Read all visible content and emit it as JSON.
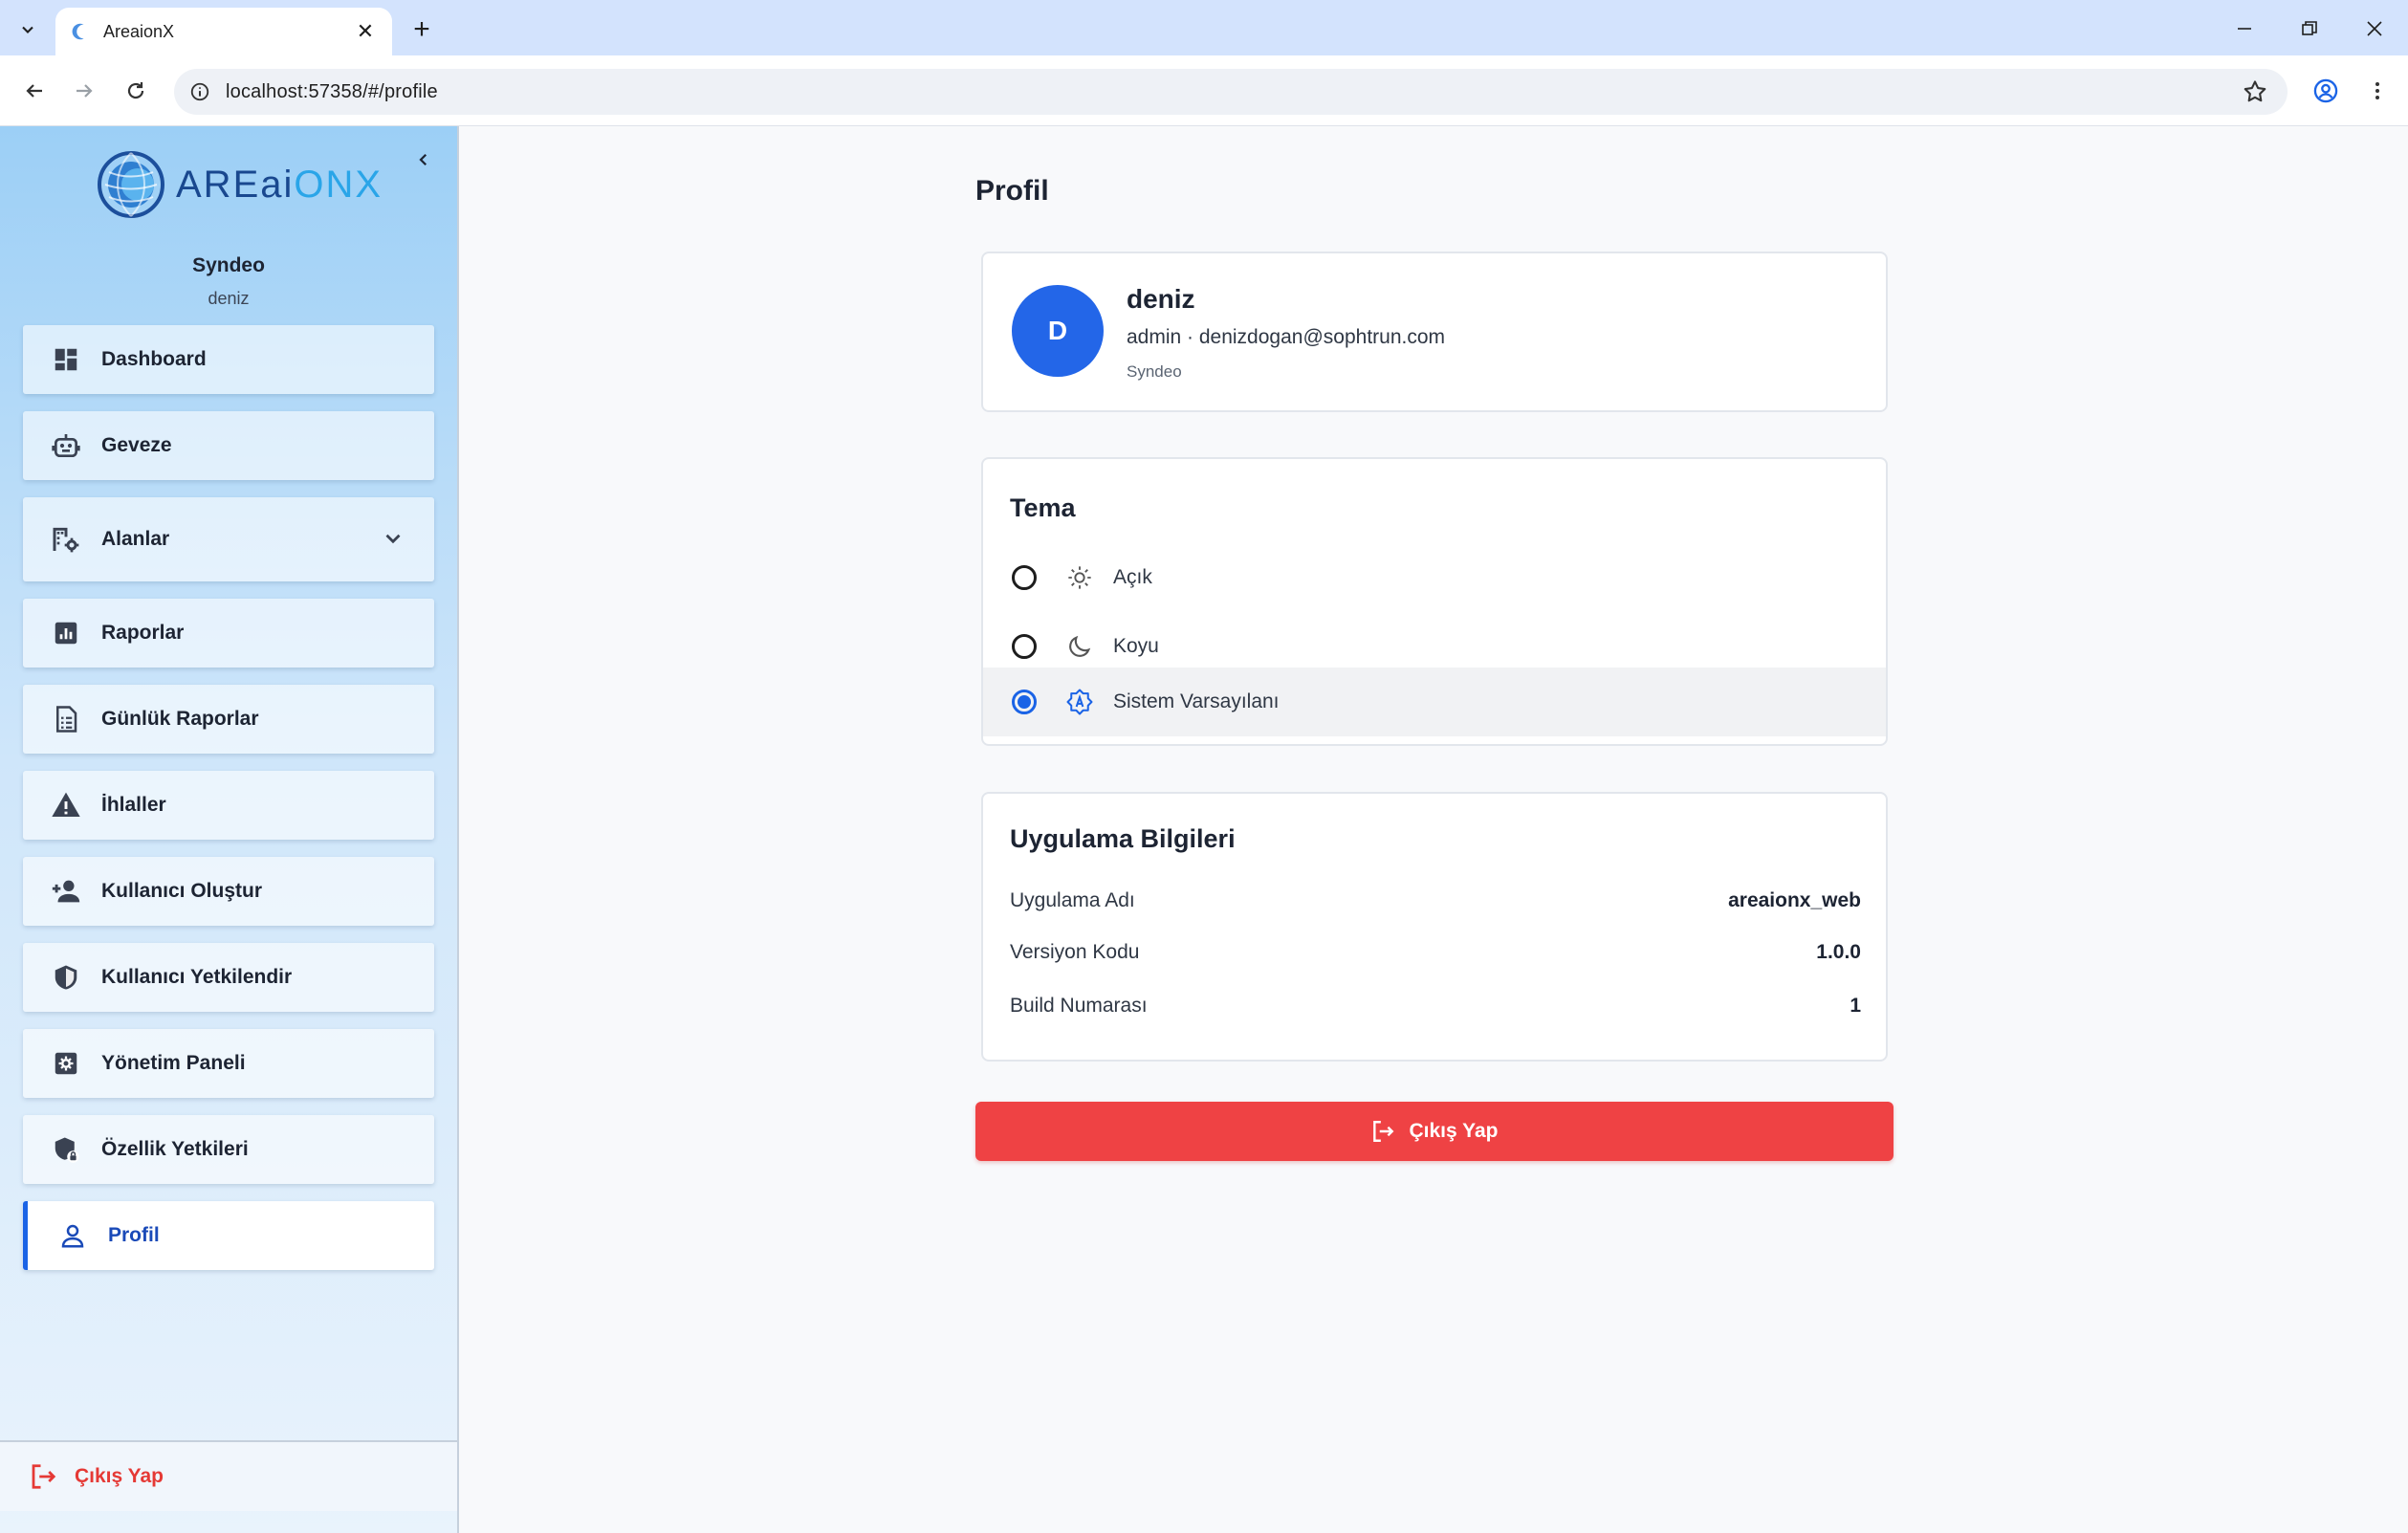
{
  "browser": {
    "tab_title": "AreaionX",
    "url": "localhost:57358/#/profile",
    "new_tab_symbol": "+",
    "close_symbol": "✕"
  },
  "sidebar": {
    "logo": {
      "part_a": "AREai",
      "part_b": "ONX"
    },
    "org_name": "Syndeo",
    "user_name": "deniz",
    "items": [
      {
        "label": "Dashboard",
        "icon": "dashboard-icon"
      },
      {
        "label": "Geveze",
        "icon": "robot-icon"
      },
      {
        "label": "Alanlar",
        "icon": "building-settings-icon",
        "expandable": true
      },
      {
        "label": "Raporlar",
        "icon": "report-chart-icon"
      },
      {
        "label": "Günlük Raporlar",
        "icon": "document-list-icon"
      },
      {
        "label": "İhlaller",
        "icon": "warning-icon"
      },
      {
        "label": "Kullanıcı Oluştur",
        "icon": "person-add-icon"
      },
      {
        "label": "Kullanıcı Yetkilendir",
        "icon": "shield-icon"
      },
      {
        "label": "Yönetim Paneli",
        "icon": "settings-box-icon"
      },
      {
        "label": "Özellik Yetkileri",
        "icon": "shield-lock-icon"
      },
      {
        "label": "Profil",
        "icon": "person-icon",
        "active": true
      }
    ],
    "logout_label": "Çıkış Yap"
  },
  "main": {
    "page_title": "Profil",
    "profile": {
      "avatar_letter": "D",
      "name": "deniz",
      "role_email": "admin · denizdogan@sophtrun.com",
      "org": "Syndeo"
    },
    "theme": {
      "title": "Tema",
      "options": [
        {
          "label": "Açık",
          "icon": "sun-icon",
          "selected": false
        },
        {
          "label": "Koyu",
          "icon": "moon-icon",
          "selected": false
        },
        {
          "label": "Sistem Varsayılanı",
          "icon": "auto-brightness-icon",
          "selected": true
        }
      ]
    },
    "app_info": {
      "title": "Uygulama Bilgileri",
      "rows": [
        {
          "key": "Uygulama Adı",
          "value": "areaionx_web"
        },
        {
          "key": "Versiyon Kodu",
          "value": "1.0.0"
        },
        {
          "key": "Build Numarası",
          "value": "1"
        }
      ]
    },
    "logout_label": "Çıkış Yap"
  },
  "colors": {
    "accent": "#1a63e6",
    "danger": "#ef4244",
    "avatar": "#2366e8"
  }
}
